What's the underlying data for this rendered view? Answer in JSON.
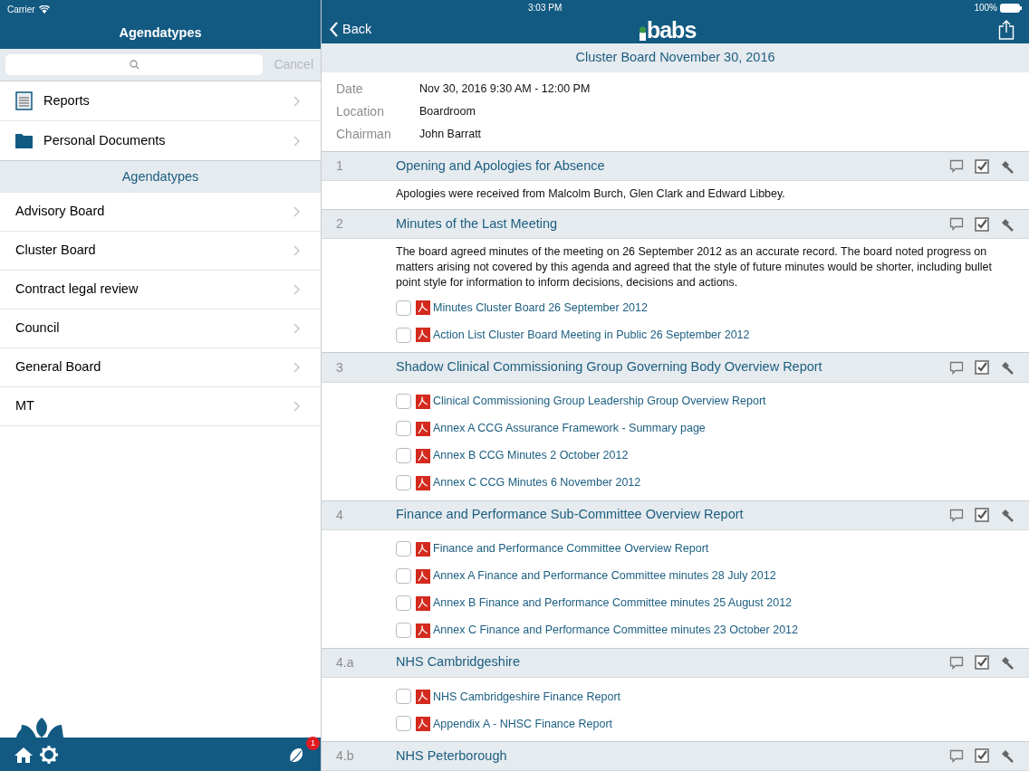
{
  "status_bar": {
    "carrier": "Carrier",
    "time": "3:03 PM",
    "battery": "100%"
  },
  "sidebar": {
    "title": "Agendatypes",
    "search": {
      "cancel": "Cancel"
    },
    "items": [
      {
        "label": "Reports",
        "kind": "reports"
      },
      {
        "label": "Personal Documents",
        "kind": "folder"
      }
    ],
    "section_title": "Agendatypes",
    "agendatypes": [
      {
        "label": "Advisory Board"
      },
      {
        "label": "Cluster Board"
      },
      {
        "label": "Contract legal review"
      },
      {
        "label": "Council"
      },
      {
        "label": "General Board"
      },
      {
        "label": "MT"
      }
    ],
    "notification_count": "1"
  },
  "header": {
    "back": "Back",
    "logo": "babs"
  },
  "meeting": {
    "title": "Cluster Board November 30, 2016",
    "details": [
      {
        "label": "Date",
        "value": "Nov 30, 2016 9:30 AM - 12:00 PM"
      },
      {
        "label": "Location",
        "value": "Boardroom"
      },
      {
        "label": "Chairman",
        "value": "John Barratt"
      }
    ],
    "agenda": [
      {
        "number": "1",
        "title": "Opening and Apologies for Absence",
        "description": "Apologies were received from Malcolm Burch, Glen Clark and Edward Libbey."
      },
      {
        "number": "2",
        "title": "Minutes of the Last Meeting",
        "description": "The board agreed minutes of the meeting on 26 September 2012 as an accurate record. The board noted progress on matters arising not covered by this agenda and agreed that the style of future minutes would be shorter, including bullet point style for information to inform decisions, decisions and actions.",
        "documents": [
          {
            "title": "Minutes Cluster Board 26 September 2012",
            "checked": false
          },
          {
            "title": "Action List Cluster Board Meeting in Public 26 September 2012",
            "checked": false
          }
        ]
      },
      {
        "number": "3",
        "title": "Shadow Clinical Commissioning Group Governing Body Overview Report",
        "documents": [
          {
            "title": "Clinical Commissioning Group Leadership Group Overview Report",
            "checked": false
          },
          {
            "title": "Annex A CCG Assurance Framework - Summary page",
            "checked": false
          },
          {
            "title": "Annex B CCG Minutes 2 October 2012",
            "checked": false
          },
          {
            "title": "Annex C CCG Minutes 6 November 2012",
            "checked": false
          }
        ]
      },
      {
        "number": "4",
        "title": "Finance and Performance Sub-Committee Overview Report",
        "documents": [
          {
            "title": "Finance and Performance Committee Overview Report",
            "checked": false
          },
          {
            "title": "Annex A Finance and Performance Committee minutes 28 July 2012",
            "checked": false
          },
          {
            "title": "Annex B Finance and Performance Committee minutes 25 August 2012",
            "checked": false
          },
          {
            "title": "Annex C Finance and Performance Committee minutes 23 October 2012",
            "checked": false
          }
        ]
      },
      {
        "number": "4.a",
        "title": "NHS Cambridgeshire",
        "documents": [
          {
            "title": "NHS Cambridgeshire Finance Report",
            "checked": false
          },
          {
            "title": "Appendix A - NHSC Finance Report",
            "checked": false
          }
        ]
      },
      {
        "number": "4.b",
        "title": "NHS Peterborough"
      }
    ]
  }
}
